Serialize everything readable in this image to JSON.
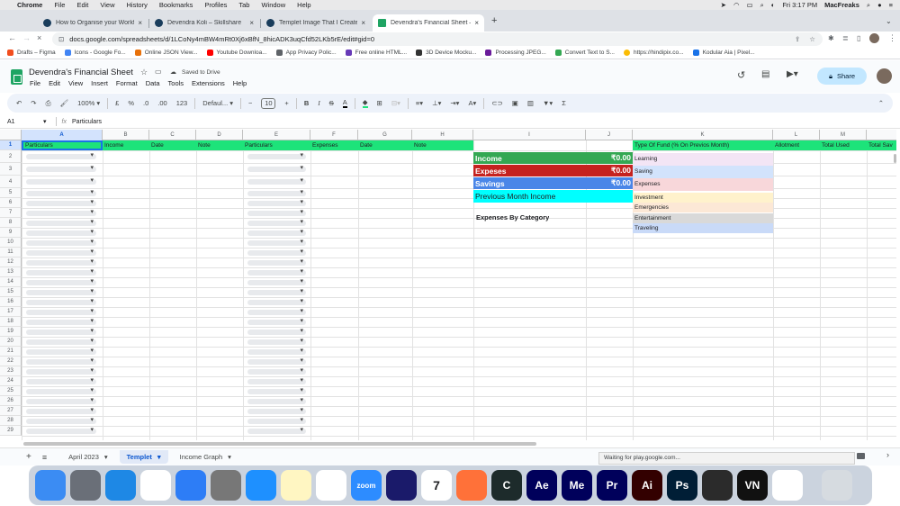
{
  "mac_menu": {
    "app": "Chrome",
    "items": [
      "File",
      "Edit",
      "View",
      "History",
      "Bookmarks",
      "Profiles",
      "Tab",
      "Window",
      "Help"
    ],
    "clock": "Fri 3:17 PM",
    "user": "MacFreaks"
  },
  "tabs": [
    {
      "title": "How to Organise your Workflo",
      "active": false,
      "fav": "globe"
    },
    {
      "title": "Devendra Koli – Skillshare",
      "active": false,
      "fav": "globe"
    },
    {
      "title": "Templet Image That I Created",
      "active": false,
      "fav": "globe"
    },
    {
      "title": "Devendra's Financial Sheet – G",
      "active": true,
      "fav": "sheet"
    }
  ],
  "address": {
    "url": "docs.google.com/spreadsheets/d/1LCoNy4mBW4mRt0Xj6xBfN_8hicADK3uqCfd52LKb5rE/edit#gid=0"
  },
  "bookmarks": [
    {
      "label": "Drafts – Figma",
      "color": "#f24e1e"
    },
    {
      "label": "Icons - Google Fo...",
      "color": "#4285f4"
    },
    {
      "label": "Online JSON View...",
      "color": "#e8710a"
    },
    {
      "label": "Youtube Downloa...",
      "color": "#ff0000"
    },
    {
      "label": "App Privacy Polic...",
      "color": "#5f6368"
    },
    {
      "label": "Free online HTML...",
      "color": "#673ab7"
    },
    {
      "label": "3D Device Mocku...",
      "color": "#333333"
    },
    {
      "label": "Processing JPEG...",
      "color": "#6a1b9a"
    },
    {
      "label": "Convert Text to S...",
      "color": "#34a853"
    },
    {
      "label": "https://hindipix.co...",
      "color": "#fbbc04"
    },
    {
      "label": "Kodular Aia | Pixel...",
      "color": "#1a73e8"
    }
  ],
  "doc": {
    "title": "Devendra's Financial Sheet",
    "saved": "Saved to Drive",
    "menus": [
      "File",
      "Edit",
      "View",
      "Insert",
      "Format",
      "Data",
      "Tools",
      "Extensions",
      "Help"
    ],
    "share": "Share"
  },
  "toolbar": {
    "zoom": "100%",
    "currency": "£",
    "percent": "%",
    "dec_down": ".0",
    "dec_up": ".00",
    "format": "123",
    "font": "Defaul...",
    "font_size": "10",
    "bold": "B",
    "italic": "I"
  },
  "formula": {
    "cell_ref": "A1",
    "fx": "fx",
    "content": "Particulars"
  },
  "columns": [
    "A",
    "B",
    "C",
    "D",
    "E",
    "F",
    "G",
    "H",
    "I",
    "J",
    "K",
    "L",
    "M"
  ],
  "row_numbers": [
    "1",
    "2",
    "3",
    "4",
    "5",
    "6",
    "7",
    "8",
    "9",
    "10",
    "11",
    "12",
    "13",
    "14",
    "15",
    "16",
    "17",
    "18",
    "19",
    "20",
    "21",
    "22",
    "23",
    "24",
    "25",
    "26",
    "27",
    "28",
    "29"
  ],
  "header_row": {
    "a": "Particulars",
    "b": "Income",
    "c": "Date",
    "d": "Note",
    "e": "Particulars",
    "f": "Expenses",
    "g": "Date",
    "h": "Note",
    "k": "Type Of Fund (% On Previos Month)",
    "l": "Allotment",
    "m": "Total Used",
    "n": "Total Sav"
  },
  "summary": [
    {
      "label": "Income",
      "value": "₹0.00",
      "color": "#34a853"
    },
    {
      "label": "Expeses",
      "value": "₹0.00",
      "color": "#c5221f"
    },
    {
      "label": "Savings",
      "value": "₹0.00",
      "color": "#4a86e8"
    },
    {
      "label": "Previous Month Income",
      "value": "",
      "color": "#00ffff"
    }
  ],
  "expenses_by_category": "Expenses By Category",
  "funds": [
    {
      "label": "Learning",
      "color": "#f3e5f5"
    },
    {
      "label": "Saving",
      "color": "#d2e3fc"
    },
    {
      "label": "Expenses",
      "color": "#f8d7da"
    },
    {
      "label": "Investment",
      "color": "#fff2cc"
    },
    {
      "label": "Emergencies",
      "color": "#fce8d6"
    },
    {
      "label": "Entertainment",
      "color": "#d9d9d9"
    },
    {
      "label": "Traveling",
      "color": "#c9daf8"
    }
  ],
  "sheet_tabs": [
    {
      "label": "April 2023",
      "active": false
    },
    {
      "label": "Templet",
      "active": true
    },
    {
      "label": "Income Graph",
      "active": false
    }
  ],
  "status": "Waiting for play.google.com...",
  "dock": [
    {
      "label": "",
      "icon": "finder-icon",
      "color": "#3b8cf3"
    },
    {
      "label": "",
      "icon": "launchpad-icon",
      "color": "#6a6f78"
    },
    {
      "label": "",
      "icon": "safari-icon",
      "color": "#1e88e5"
    },
    {
      "label": "",
      "icon": "numbers-icon",
      "color": "#ffffff"
    },
    {
      "label": "",
      "icon": "keynote-icon",
      "color": "#2d7df6"
    },
    {
      "label": "",
      "icon": "calculator-icon",
      "color": "#777777"
    },
    {
      "label": "",
      "icon": "app-store-icon",
      "color": "#1e90ff"
    },
    {
      "label": "",
      "icon": "notes-icon",
      "color": "#fff6c2"
    },
    {
      "label": "",
      "icon": "reminders-icon",
      "color": "#ffffff"
    },
    {
      "label": "zoom",
      "icon": "zoom-icon",
      "color": "#2d8cff"
    },
    {
      "label": "",
      "icon": "audio-icon",
      "color": "#1a1a6a"
    },
    {
      "label": "7",
      "icon": "calendar-icon",
      "color": "#ffffff"
    },
    {
      "label": "",
      "icon": "firefox-icon",
      "color": "#ff7139"
    },
    {
      "label": "C",
      "icon": "cursor-app-icon",
      "color": "#1d2b2b"
    },
    {
      "label": "Ae",
      "icon": "after-effects-icon",
      "color": "#00005b"
    },
    {
      "label": "Me",
      "icon": "media-encoder-icon",
      "color": "#00005b"
    },
    {
      "label": "Pr",
      "icon": "premiere-icon",
      "color": "#00005b"
    },
    {
      "label": "Ai",
      "icon": "illustrator-icon",
      "color": "#330000"
    },
    {
      "label": "Ps",
      "icon": "photoshop-icon",
      "color": "#001e36"
    },
    {
      "label": "",
      "icon": "davinci-icon",
      "color": "#2b2b2b"
    },
    {
      "label": "VN",
      "icon": "vn-icon",
      "color": "#111111"
    },
    {
      "label": "",
      "icon": "chrome-icon",
      "color": "#ffffff"
    },
    {
      "label": "",
      "icon": "trash-icon",
      "color": "#d6dbe0"
    }
  ]
}
